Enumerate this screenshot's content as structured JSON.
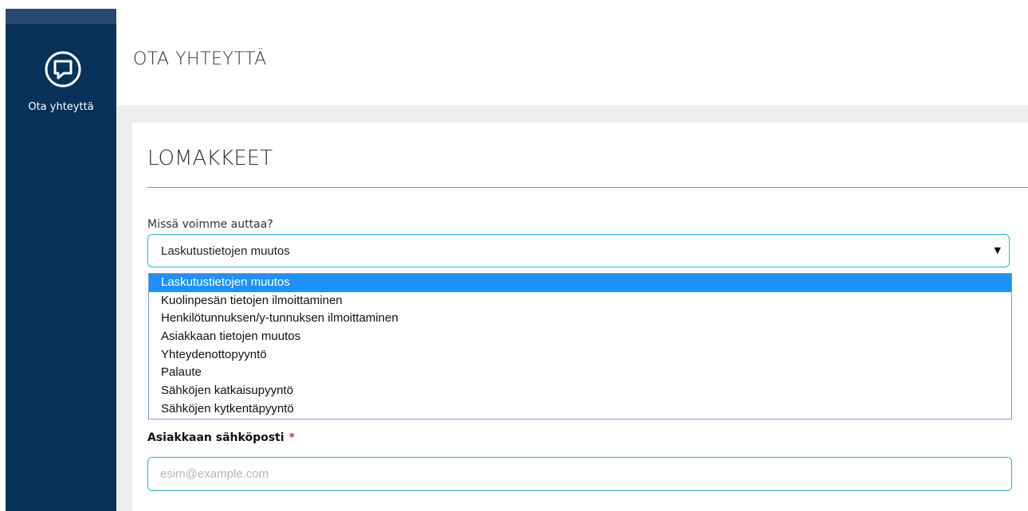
{
  "sidebar": {
    "items": [
      {
        "label": "Ota yhteyttä",
        "icon": "chat-icon"
      }
    ]
  },
  "header": {
    "title": "OTA YHTEYTTÄ"
  },
  "form": {
    "section_title": "LOMAKKEET",
    "topic": {
      "label": "Missä voimme auttaa?",
      "selected": "Laskutustietojen muutos",
      "options": [
        "Laskutustietojen muutos",
        "Kuolinpesän tietojen ilmoittaminen",
        "Henkilötunnuksen/y-tunnuksen ilmoittaminen",
        "Asiakkaan tietojen muutos",
        "Yhteydenottopyyntö",
        "Palaute",
        "Sähköjen katkaisupyyntö",
        "Sähköjen kytkentäpyyntö"
      ]
    },
    "email": {
      "label": "Asiakkaan sähköposti",
      "required_mark": "*",
      "placeholder": "esim@example.com",
      "value": ""
    }
  },
  "colors": {
    "sidebar": "#08315a",
    "accent": "#2db3d7",
    "option_highlight": "#1e90ff",
    "required": "#d6286a"
  }
}
